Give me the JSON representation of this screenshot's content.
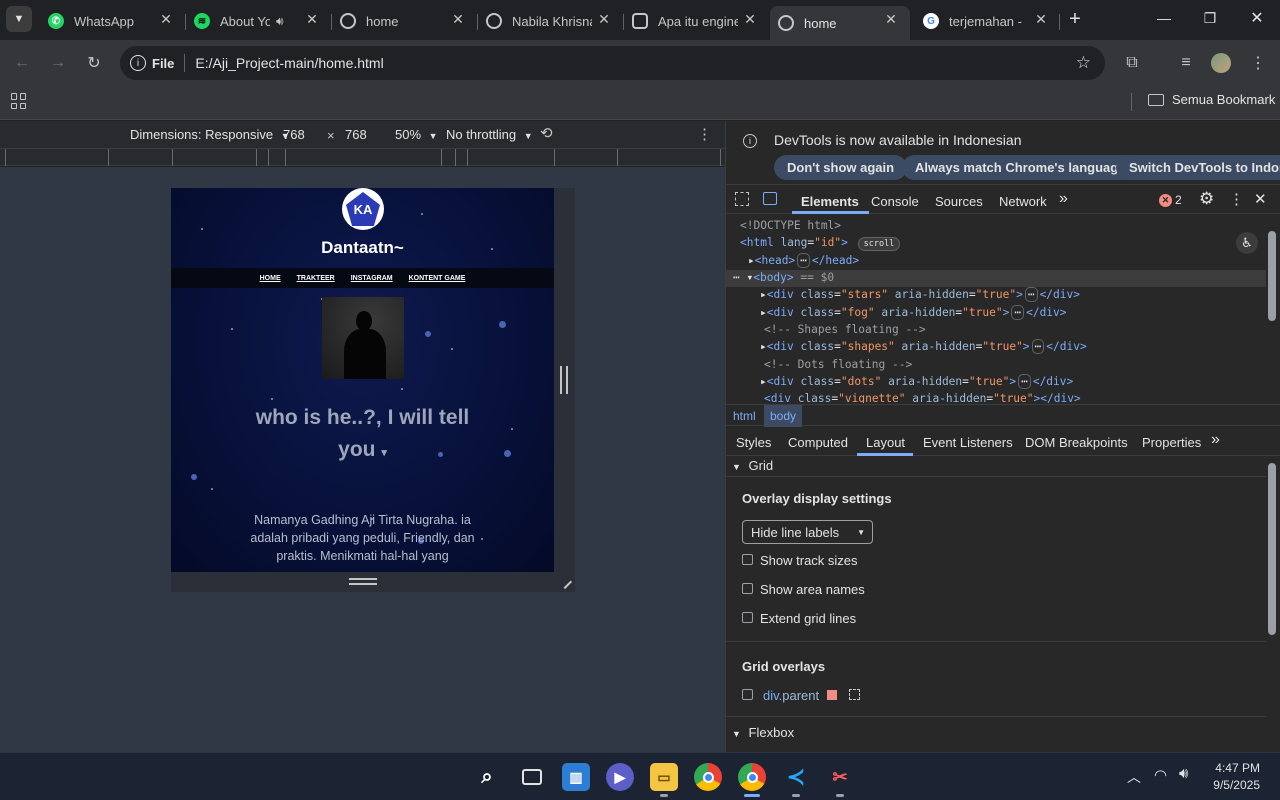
{
  "tabs": [
    {
      "title": "WhatsApp",
      "icon": "whatsapp-icon",
      "color": "#25d366"
    },
    {
      "title": "About You",
      "icon": "spotify-icon",
      "color": "#1ed760"
    },
    {
      "title": "home",
      "icon": "globe-icon",
      "color": "#9aa0a6"
    },
    {
      "title": "Nabila Khrisna",
      "icon": "globe-icon",
      "color": "#9aa0a6"
    },
    {
      "title": "Apa itu engine",
      "icon": "chatgpt-icon",
      "color": "#9aa0a6"
    },
    {
      "title": "home",
      "icon": "globe-icon",
      "color": "#9aa0a6"
    },
    {
      "title": "terjemahan - ",
      "icon": "google-icon",
      "color": "#4285f4"
    }
  ],
  "omnibox": {
    "scheme": "File",
    "url": "E:/Aji_Project-main/home.html"
  },
  "bookmarks": {
    "all_label": "Semua Bookmark"
  },
  "device_toolbar": {
    "dimensions_label": "Dimensions: Responsive",
    "width": "768",
    "height": "768",
    "times": "×",
    "zoom": "50%",
    "throttling": "No throttling"
  },
  "site": {
    "logo_text": "KA",
    "title": "Dantaatn~",
    "nav": [
      "HOME",
      "TRAKTEER",
      "INSTAGRAM",
      "KONTENT GAME"
    ],
    "heading_line1": "who is he..?, I will tell",
    "heading_line2": "you",
    "caret": "▾",
    "para_line1": "Namanya Gadhing Aji Tirta Nugraha. ia",
    "para_line2": "adalah pribadi yang peduli, Friendly, dan",
    "para_line3": "praktis. Menikmati hal-hal yang"
  },
  "devtools": {
    "banner_text": "DevTools is now available in Indonesian",
    "banner_buttons": [
      "Don't show again",
      "Always match Chrome's language",
      "Switch DevTools to Indonesi"
    ],
    "main_tabs": [
      "Elements",
      "Console",
      "Sources",
      "Network"
    ],
    "more": "»",
    "error_count": "2",
    "dom_lines": {
      "doctype": "<!DOCTYPE html>",
      "html_tag": "<html",
      "html_attr": "lang",
      "html_val": "\"id\"",
      "scroll_badge": "scroll",
      "head_open": "<head>",
      "head_close": "</head>",
      "body_tag": "<body>",
      "body_eq": "== $0",
      "div_stars_class": "\"stars\"",
      "div_fog_class": "\"fog\"",
      "comment_shapes": "<!-- Shapes floating -->",
      "div_shapes_class": "\"shapes\"",
      "comment_dots": "<!-- Dots floating -->",
      "div_dots_class": "\"dots\"",
      "div_vignette_class": "\"vignette\"",
      "aria": "aria-hidden",
      "aria_val": "\"true\"",
      "div_open": "<div",
      "class_attr": "class",
      "div_close": "</div>",
      "ellipsis": "⋯"
    },
    "breadcrumbs": [
      "html",
      "body"
    ],
    "sub_tabs": [
      "Styles",
      "Computed",
      "Layout",
      "Event Listeners",
      "DOM Breakpoints",
      "Properties"
    ],
    "grid": {
      "section": "Grid",
      "overlay_title": "Overlay display settings",
      "select_value": "Hide line labels",
      "options": [
        "Show track sizes",
        "Show area names",
        "Extend grid lines"
      ],
      "overlays_title": "Grid overlays",
      "overlay_item_tag": "div",
      "overlay_item_class": ".parent",
      "overlay_color": "#ef8c85"
    },
    "flexbox_section": "Flexbox"
  },
  "taskbar": {
    "time": "4:47 PM",
    "date": "9/5/2025"
  }
}
